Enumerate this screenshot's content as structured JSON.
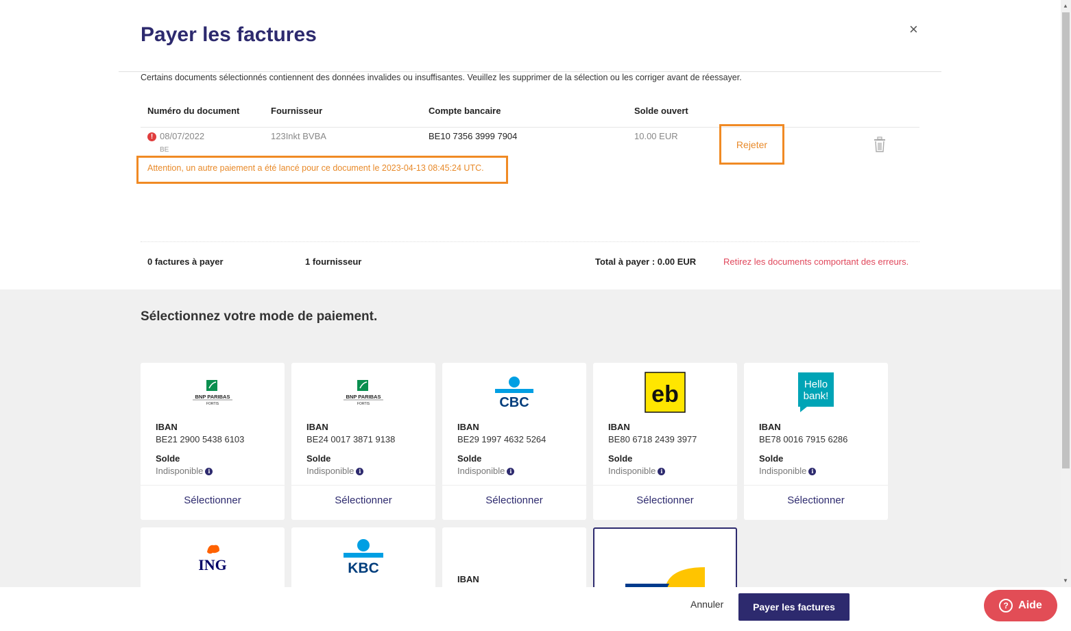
{
  "modal": {
    "title": "Payer les factures",
    "close": "×",
    "warning": "Certains documents sélectionnés contiennent des données invalides ou insuffisantes. Veuillez les supprimer de la sélection ou les corriger avant de réessayer."
  },
  "table": {
    "headers": [
      "Numéro du document",
      "Fournisseur",
      "Compte bancaire",
      "Solde ouvert"
    ],
    "row": {
      "error_icon": "!",
      "doc_number": "08/07/2022",
      "country": "BE",
      "supplier": "123Inkt BVBA",
      "bank_account": "BE10 7356 3999 7904",
      "open_balance": "10.00 EUR",
      "reject_label": "Rejeter",
      "attention": "Attention, un autre paiement a été lancé pour ce document le 2023-04-13 08:45:24 UTC."
    }
  },
  "summary": {
    "invoices": "0 factures à payer",
    "suppliers": "1 fournisseur",
    "total": "Total à payer : 0.00 EUR",
    "remove_errors": "Retirez les documents comportant des erreurs."
  },
  "payment": {
    "title": "Sélectionnez votre mode de paiement.",
    "iban_label": "IBAN",
    "balance_label": "Solde",
    "unavailable": "Indisponible",
    "select_label": "Sélectionner",
    "cards": [
      {
        "bank": "BNP PARIBAS FORTIS",
        "logo_line1": "BNP PARIBAS",
        "logo_line2": "FORTIS",
        "iban": "BE21 2900 5438 6103"
      },
      {
        "bank": "BNP PARIBAS FORTIS",
        "logo_line1": "BNP PARIBAS",
        "logo_line2": "FORTIS",
        "iban": "BE24 0017 3871 9138"
      },
      {
        "bank": "CBC",
        "logo_line1": "CBC",
        "iban": "BE29 1997 4632 5264"
      },
      {
        "bank": "eb",
        "logo_line1": "eb",
        "iban": "BE80 6718 2439 3977"
      },
      {
        "bank": "Hello bank!",
        "logo_line1": "Hello",
        "logo_line2": "bank!",
        "iban": "BE78 0016 7915 6286"
      }
    ],
    "cards_row2": [
      {
        "bank": "ING",
        "logo_line1": "ING"
      },
      {
        "bank": "KBC",
        "logo_line1": "KBC"
      },
      {
        "bank": "",
        "iban_label": "IBAN"
      },
      {
        "bank": "Belfius"
      }
    ]
  },
  "footer": {
    "cancel": "Annuler",
    "pay": "Payer les factures",
    "help": "Aide",
    "help_icon": "?"
  },
  "colors": {
    "brand": "#2d2a6e",
    "warning_orange": "#f08a24",
    "error_red": "#e03d3d",
    "help_red": "#e24d56"
  }
}
